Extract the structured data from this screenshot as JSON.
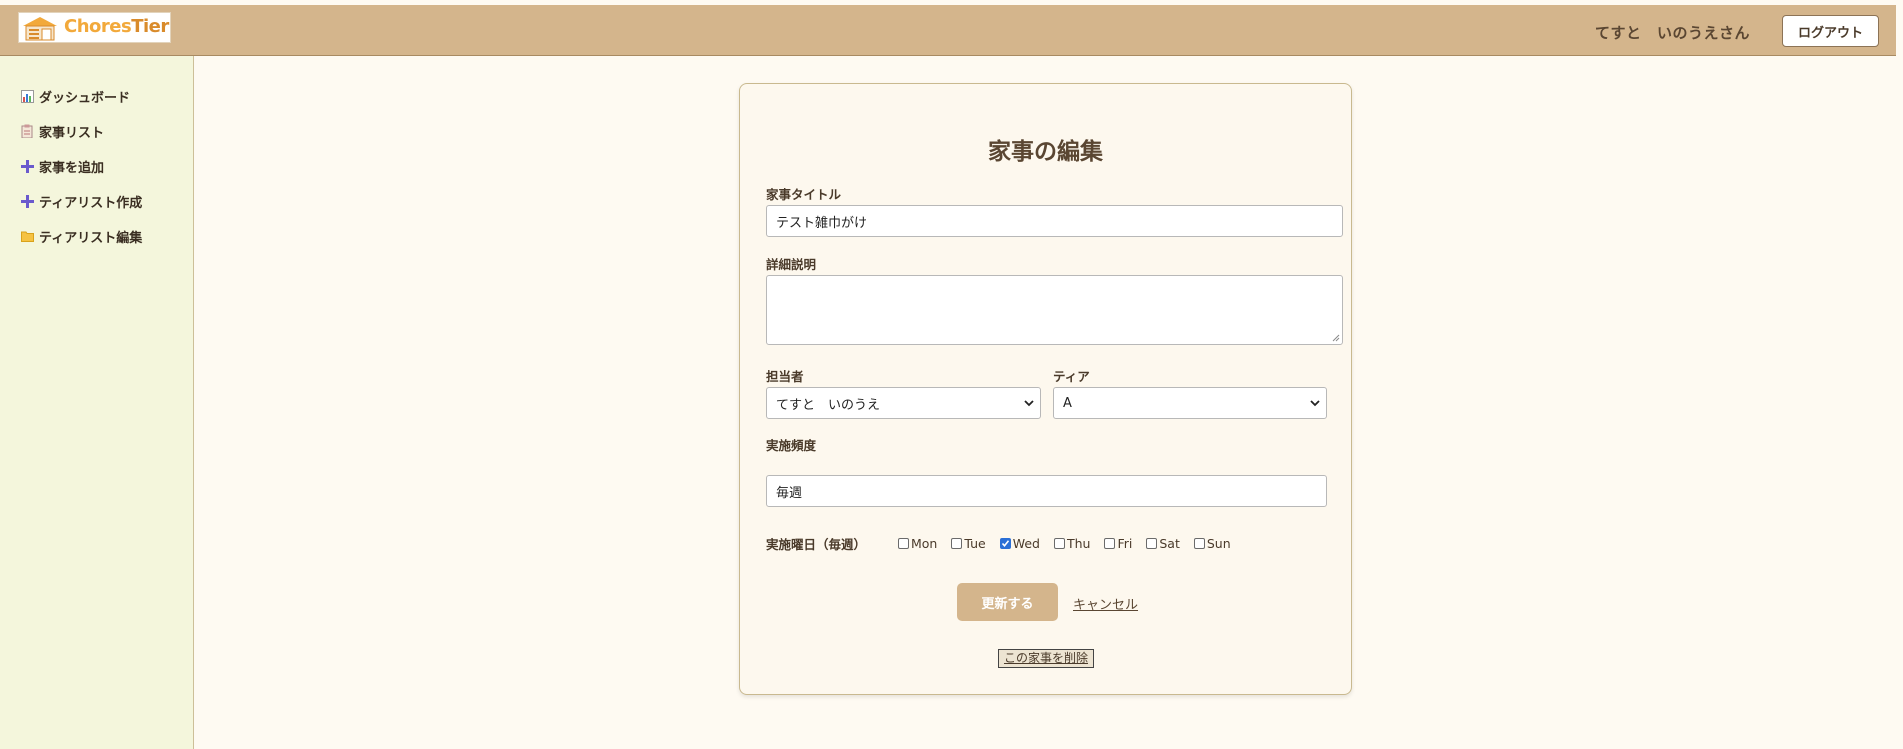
{
  "header": {
    "brand_part1": "Chores",
    "brand_part2": "Tier",
    "user_name": "てすと　いのうえさん",
    "logout_label": "ログアウト",
    "colors": {
      "header_bg": "#d4b58c",
      "brand_orange": "#f2a93b"
    }
  },
  "sidebar": {
    "items": [
      {
        "label": "ダッシュボード",
        "icon": "bar-chart-icon"
      },
      {
        "label": "家事リスト",
        "icon": "clipboard-icon"
      },
      {
        "label": "家事を追加",
        "icon": "plus-icon"
      },
      {
        "label": "ティアリスト作成",
        "icon": "plus-icon"
      },
      {
        "label": "ティアリスト編集",
        "icon": "folder-icon"
      }
    ]
  },
  "form": {
    "title": "家事の編集",
    "title_label": "家事タイトル",
    "title_value": "テスト雑巾がけ",
    "description_label": "詳細説明",
    "description_value": "",
    "assignee_label": "担当者",
    "assignee_value": "てすと　いのうえ",
    "tier_label": "ティア",
    "tier_value": "A",
    "frequency_label": "実施頻度",
    "frequency_value": "毎週",
    "days_label": "実施曜日（毎週）",
    "days": [
      {
        "label": "Mon",
        "checked": false
      },
      {
        "label": "Tue",
        "checked": false
      },
      {
        "label": "Wed",
        "checked": true
      },
      {
        "label": "Thu",
        "checked": false
      },
      {
        "label": "Fri",
        "checked": false
      },
      {
        "label": "Sat",
        "checked": false
      },
      {
        "label": "Sun",
        "checked": false
      }
    ],
    "submit_label": "更新する",
    "cancel_label": "キャンセル",
    "delete_label": "この家事を削除"
  }
}
